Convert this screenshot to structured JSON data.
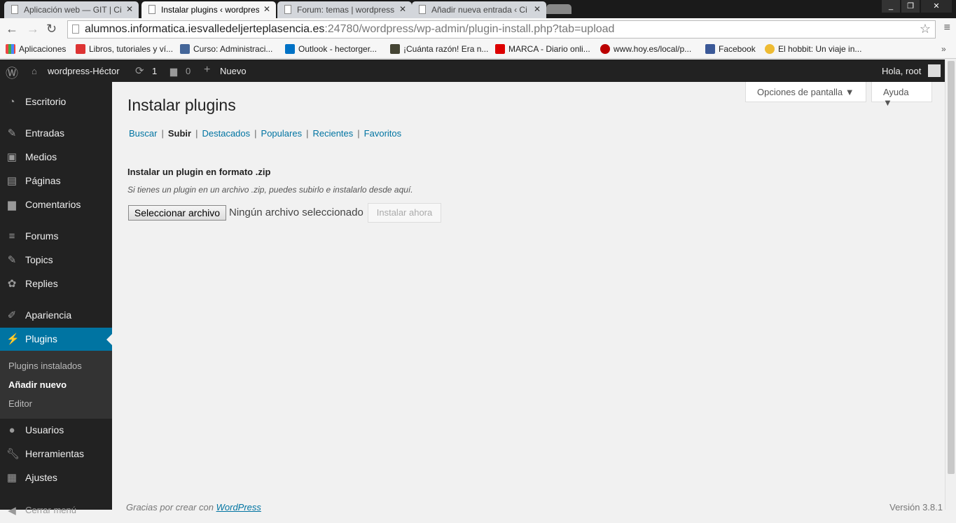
{
  "browser": {
    "tabs": [
      {
        "title": "Aplicación web — GIT | Ci",
        "active": false
      },
      {
        "title": "Instalar plugins ‹ wordpress",
        "active": true
      },
      {
        "title": "Forum: temas | wordpress",
        "active": false
      },
      {
        "title": "Añadir nueva entrada ‹ Ci",
        "active": false
      }
    ],
    "url_host": "alumnos.informatica.iesvalledeljerteplasencia.es",
    "url_rest": ":24780/wordpress/wp-admin/plugin-install.php?tab=upload",
    "bookmarks": [
      "Aplicaciones",
      "Libros, tutoriales y ví...",
      "Curso: Administraci...",
      "Outlook - hectorger...",
      "¡Cuánta razón! Era n...",
      "MARCA - Diario onli...",
      "www.hoy.es/local/p...",
      "Facebook",
      "El hobbit: Un viaje in..."
    ]
  },
  "adminbar": {
    "site": "wordpress-Héctor",
    "updates": "1",
    "comments": "0",
    "new": "Nuevo",
    "greeting": "Hola, root"
  },
  "sidebar": {
    "items": [
      "Escritorio",
      "Entradas",
      "Medios",
      "Páginas",
      "Comentarios",
      "Forums",
      "Topics",
      "Replies",
      "Apariencia",
      "Plugins",
      "Usuarios",
      "Herramientas",
      "Ajustes",
      "Cerrar menú"
    ],
    "submenu": [
      "Plugins instalados",
      "Añadir nuevo",
      "Editor"
    ]
  },
  "page": {
    "title": "Instalar plugins",
    "screen_options": "Opciones de pantalla ▼",
    "help": "Ayuda ▼",
    "subnav": [
      "Buscar",
      "Subir",
      "Destacados",
      "Populares",
      "Recientes",
      "Favoritos"
    ],
    "heading": "Instalar un plugin en formato .zip",
    "description": "Si tienes un plugin en un archivo .zip, puedes subirlo e instalarlo desde aquí.",
    "file_button": "Seleccionar archivo",
    "no_file": "Ningún archivo seleccionado",
    "install_button": "Instalar ahora"
  },
  "footer": {
    "thanks": "Gracias por crear con ",
    "wp_link": "WordPress",
    "version": "Versión 3.8.1"
  }
}
